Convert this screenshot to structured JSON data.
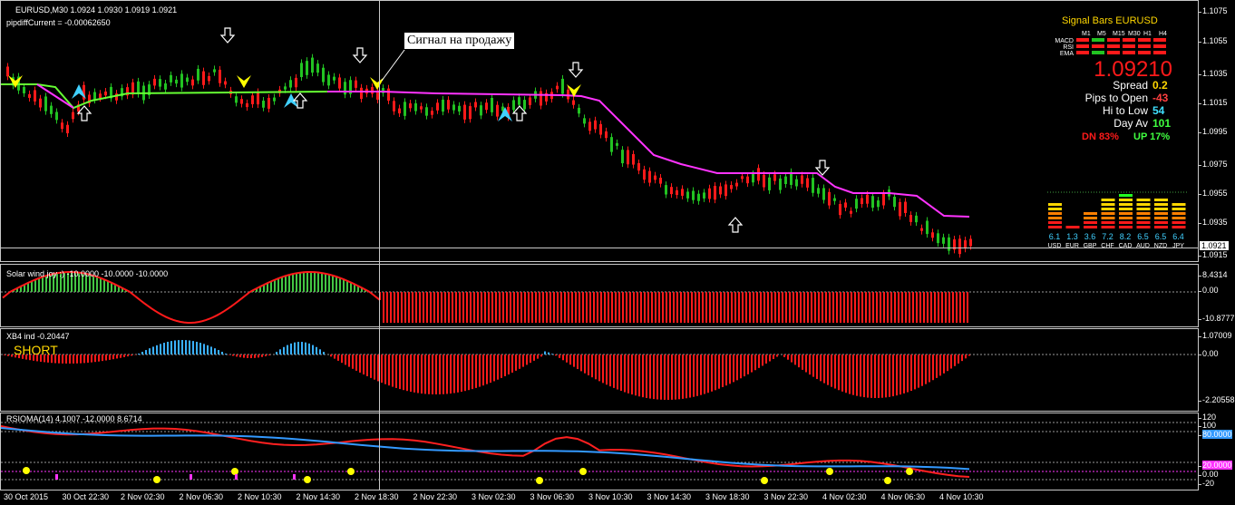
{
  "chart_header": {
    "symbol_info": "EURUSD,M30  1.0924 1.0930 1.0919 1.0921",
    "pipdiff": "pipdiffCurrent = -0.00062650"
  },
  "price_axis": [
    "1.1075",
    "1.1055",
    "1.1035",
    "1.1015",
    "1.0995",
    "1.0975",
    "1.0955",
    "1.0935",
    "1.0915"
  ],
  "current_price": "1.0921",
  "callout": "Сигнал на продажу",
  "signal_panel": {
    "title": "Signal Bars EURUSD",
    "timeframes": [
      "M1",
      "M5",
      "M15",
      "M30",
      "H1",
      "H4"
    ],
    "rows": [
      "MACD",
      "RSI",
      "EMA"
    ],
    "price": "1.09210",
    "stats": [
      {
        "label": "Spread",
        "value": "0.2",
        "color": "#ffd700"
      },
      {
        "label": "Pips to Open",
        "value": "-43",
        "color": "#ff4040"
      },
      {
        "label": "Hi to Low",
        "value": "54",
        "color": "#40e0ff"
      },
      {
        "label": "Day Av",
        "value": "101",
        "color": "#40ff40"
      }
    ],
    "dn": "DN 83%",
    "up": "UP 17%"
  },
  "currency_meter": {
    "values": [
      "6.1",
      "1.3",
      "3.6",
      "7.2",
      "8.2",
      "6.5",
      "6.5",
      "6.4"
    ],
    "currencies": [
      "USD",
      "EUR",
      "GBP",
      "CHF",
      "CAD",
      "AUD",
      "NZD",
      "JPY"
    ]
  },
  "indicators": {
    "solar": {
      "title": "Solar wind joy :) -10.0000 -10.0000 -10.0000",
      "axis": [
        "8.4314",
        "0.00",
        "-10.8777"
      ]
    },
    "xb4": {
      "title": "XB4 ind -0.20447",
      "signal": "SHORT",
      "axis": [
        "1.07009",
        "0.00",
        "-2.20558"
      ]
    },
    "rsioma": {
      "title": "RSIOMA(14) 4.1007 -12.0000 8.6714",
      "axis": [
        "120",
        "100",
        "80.0000",
        "20.0000",
        "0.00",
        "-20"
      ]
    }
  },
  "time_axis": [
    "30 Oct 2015",
    "30 Oct 22:30",
    "2 Nov 02:30",
    "2 Nov 06:30",
    "2 Nov 10:30",
    "2 Nov 14:30",
    "2 Nov 18:30",
    "2 Nov 22:30",
    "3 Nov 02:30",
    "3 Nov 06:30",
    "3 Nov 10:30",
    "3 Nov 14:30",
    "3 Nov 18:30",
    "3 Nov 22:30",
    "4 Nov 02:30",
    "4 Nov 06:30",
    "4 Nov 10:30"
  ],
  "colors": {
    "bull": "#22c322",
    "bear": "#ff1a1a",
    "trail_up": "#66ff33",
    "trail_down": "#ff33ff",
    "rsi_red": "#ff2020",
    "rsi_blue": "#3399ff",
    "yellow": "#ffff00"
  }
}
